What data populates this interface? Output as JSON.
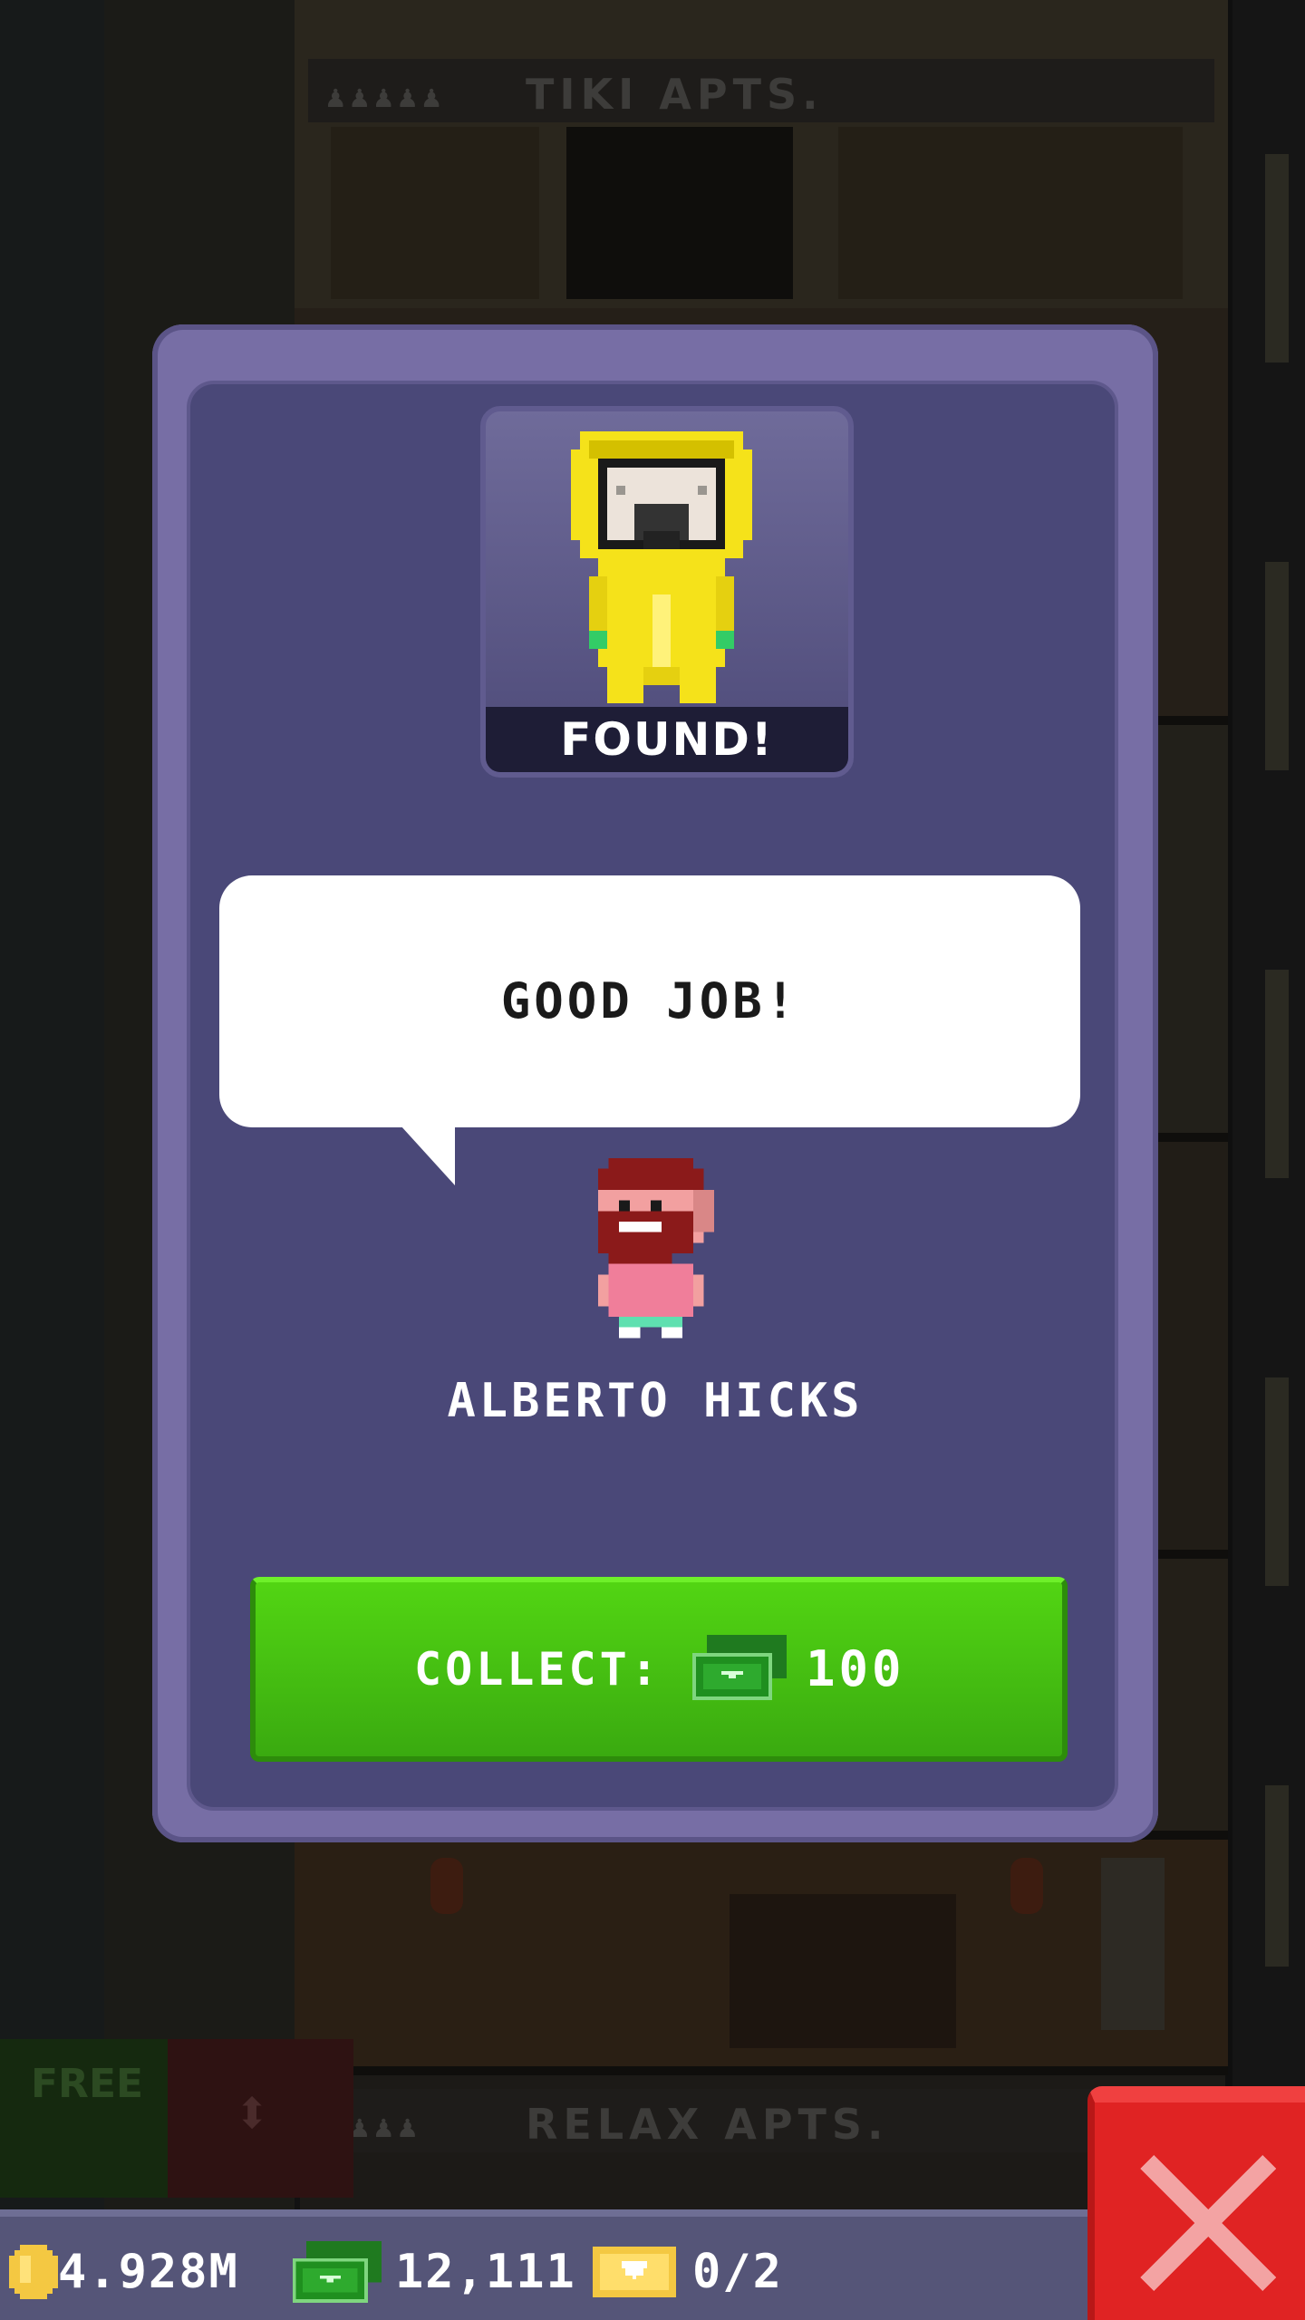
{
  "background": {
    "top_floor_sign": "TIKI APTS.",
    "bottom_floor_sign": "RELAX APTS.",
    "free_button_label": "FREE"
  },
  "modal": {
    "status": "FOUND!",
    "speech": "GOOD JOB!",
    "npc_name": "ALBERTO HICKS",
    "collect": {
      "label": "COLLECT:",
      "amount": "100",
      "currency_icon": "bux-cash-icon"
    }
  },
  "hud": {
    "coins": "4.928M",
    "bux": "12,111",
    "tickets": "0/2",
    "coin_icon": "gold-coin-icon",
    "bux_icon": "bux-cash-icon",
    "ticket_icon": "golden-ticket-icon"
  },
  "colors": {
    "modal_frame": "#776ea5",
    "modal_body": "#4a4878",
    "collect_green": "#46c011",
    "close_red": "#e02323",
    "hud_bar": "#555578"
  }
}
